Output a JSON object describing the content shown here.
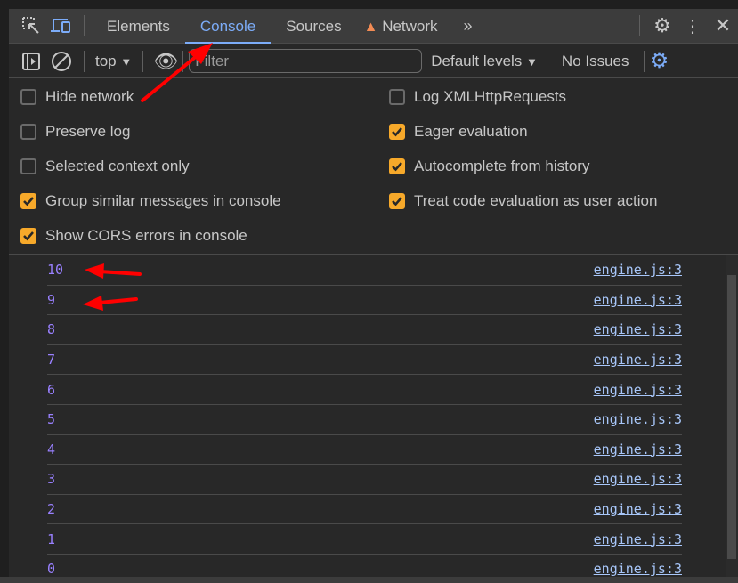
{
  "tabs": [
    {
      "label": "Elements"
    },
    {
      "label": "Console",
      "active": true
    },
    {
      "label": "Sources"
    },
    {
      "label": "Network",
      "warning": true
    }
  ],
  "toolbar": {
    "context": "top",
    "filter_placeholder": "Filter",
    "levels": "Default levels",
    "issues": "No Issues"
  },
  "settings": {
    "left": [
      {
        "label": "Hide network",
        "checked": false
      },
      {
        "label": "Preserve log",
        "checked": false
      },
      {
        "label": "Selected context only",
        "checked": false
      },
      {
        "label": "Group similar messages in console",
        "checked": true
      },
      {
        "label": "Show CORS errors in console",
        "checked": true
      }
    ],
    "right": [
      {
        "label": "Log XMLHttpRequests",
        "checked": false
      },
      {
        "label": "Eager evaluation",
        "checked": true
      },
      {
        "label": "Autocomplete from history",
        "checked": true
      },
      {
        "label": "Treat code evaluation as user action",
        "checked": true
      }
    ]
  },
  "console": [
    {
      "value": "10",
      "source": "engine.js:3"
    },
    {
      "value": "9",
      "source": "engine.js:3"
    },
    {
      "value": "8",
      "source": "engine.js:3"
    },
    {
      "value": "7",
      "source": "engine.js:3"
    },
    {
      "value": "6",
      "source": "engine.js:3"
    },
    {
      "value": "5",
      "source": "engine.js:3"
    },
    {
      "value": "4",
      "source": "engine.js:3"
    },
    {
      "value": "3",
      "source": "engine.js:3"
    },
    {
      "value": "2",
      "source": "engine.js:3"
    },
    {
      "value": "1",
      "source": "engine.js:3"
    },
    {
      "value": "0",
      "source": "engine.js:3"
    }
  ],
  "colors": {
    "accent": "#7cacf8",
    "checkbox": "#f7a92a",
    "number": "#9980ff",
    "annotation": "#ff0000"
  }
}
